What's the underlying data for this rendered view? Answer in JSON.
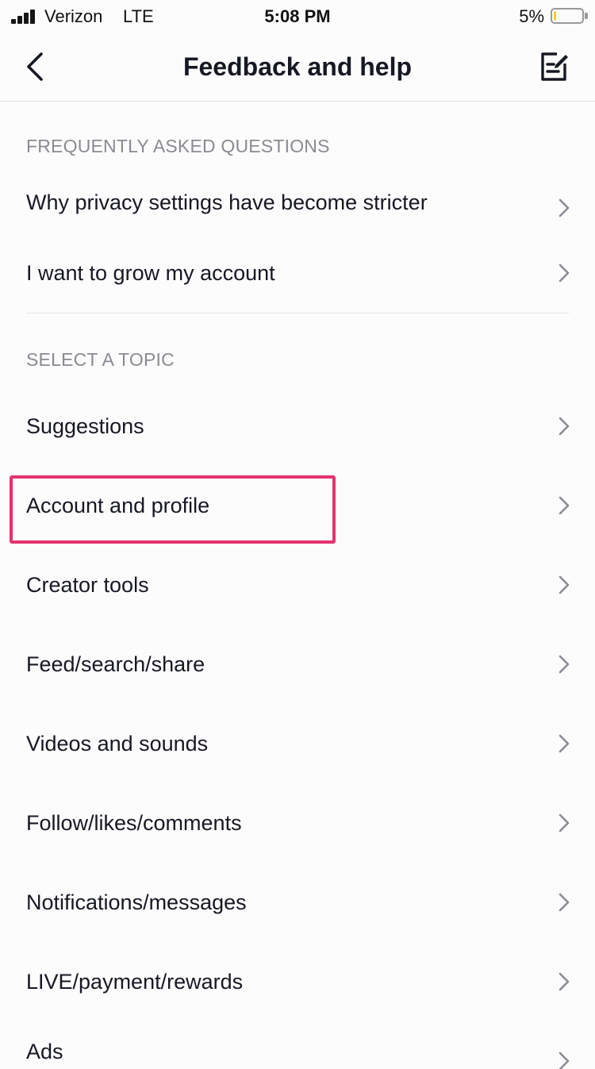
{
  "status_bar": {
    "carrier": "Verizon",
    "network": "LTE",
    "time": "5:08 PM",
    "battery_percent": "5%",
    "battery_level": 0.05,
    "battery_color": "#f5d32e"
  },
  "nav": {
    "back_icon": "chevron-left-icon",
    "title": "Feedback and help",
    "edit_icon": "compose-report-icon"
  },
  "sections": {
    "faq": {
      "header": "FREQUENTLY ASKED QUESTIONS",
      "items": [
        {
          "label": "Why privacy settings have become stricter"
        },
        {
          "label": "I want to grow my account"
        }
      ]
    },
    "topics": {
      "header": "SELECT A TOPIC",
      "items": [
        {
          "label": "Suggestions"
        },
        {
          "label": "Account and profile",
          "highlighted": true
        },
        {
          "label": "Creator tools"
        },
        {
          "label": "Feed/search/share"
        },
        {
          "label": "Videos and sounds"
        },
        {
          "label": "Follow/likes/comments"
        },
        {
          "label": "Notifications/messages"
        },
        {
          "label": "LIVE/payment/rewards"
        },
        {
          "label": "Ads"
        }
      ]
    }
  },
  "colors": {
    "highlight": "#e4336e",
    "section_header": "#8a8b91",
    "text": "#161823",
    "chevron": "#8a8b91"
  }
}
